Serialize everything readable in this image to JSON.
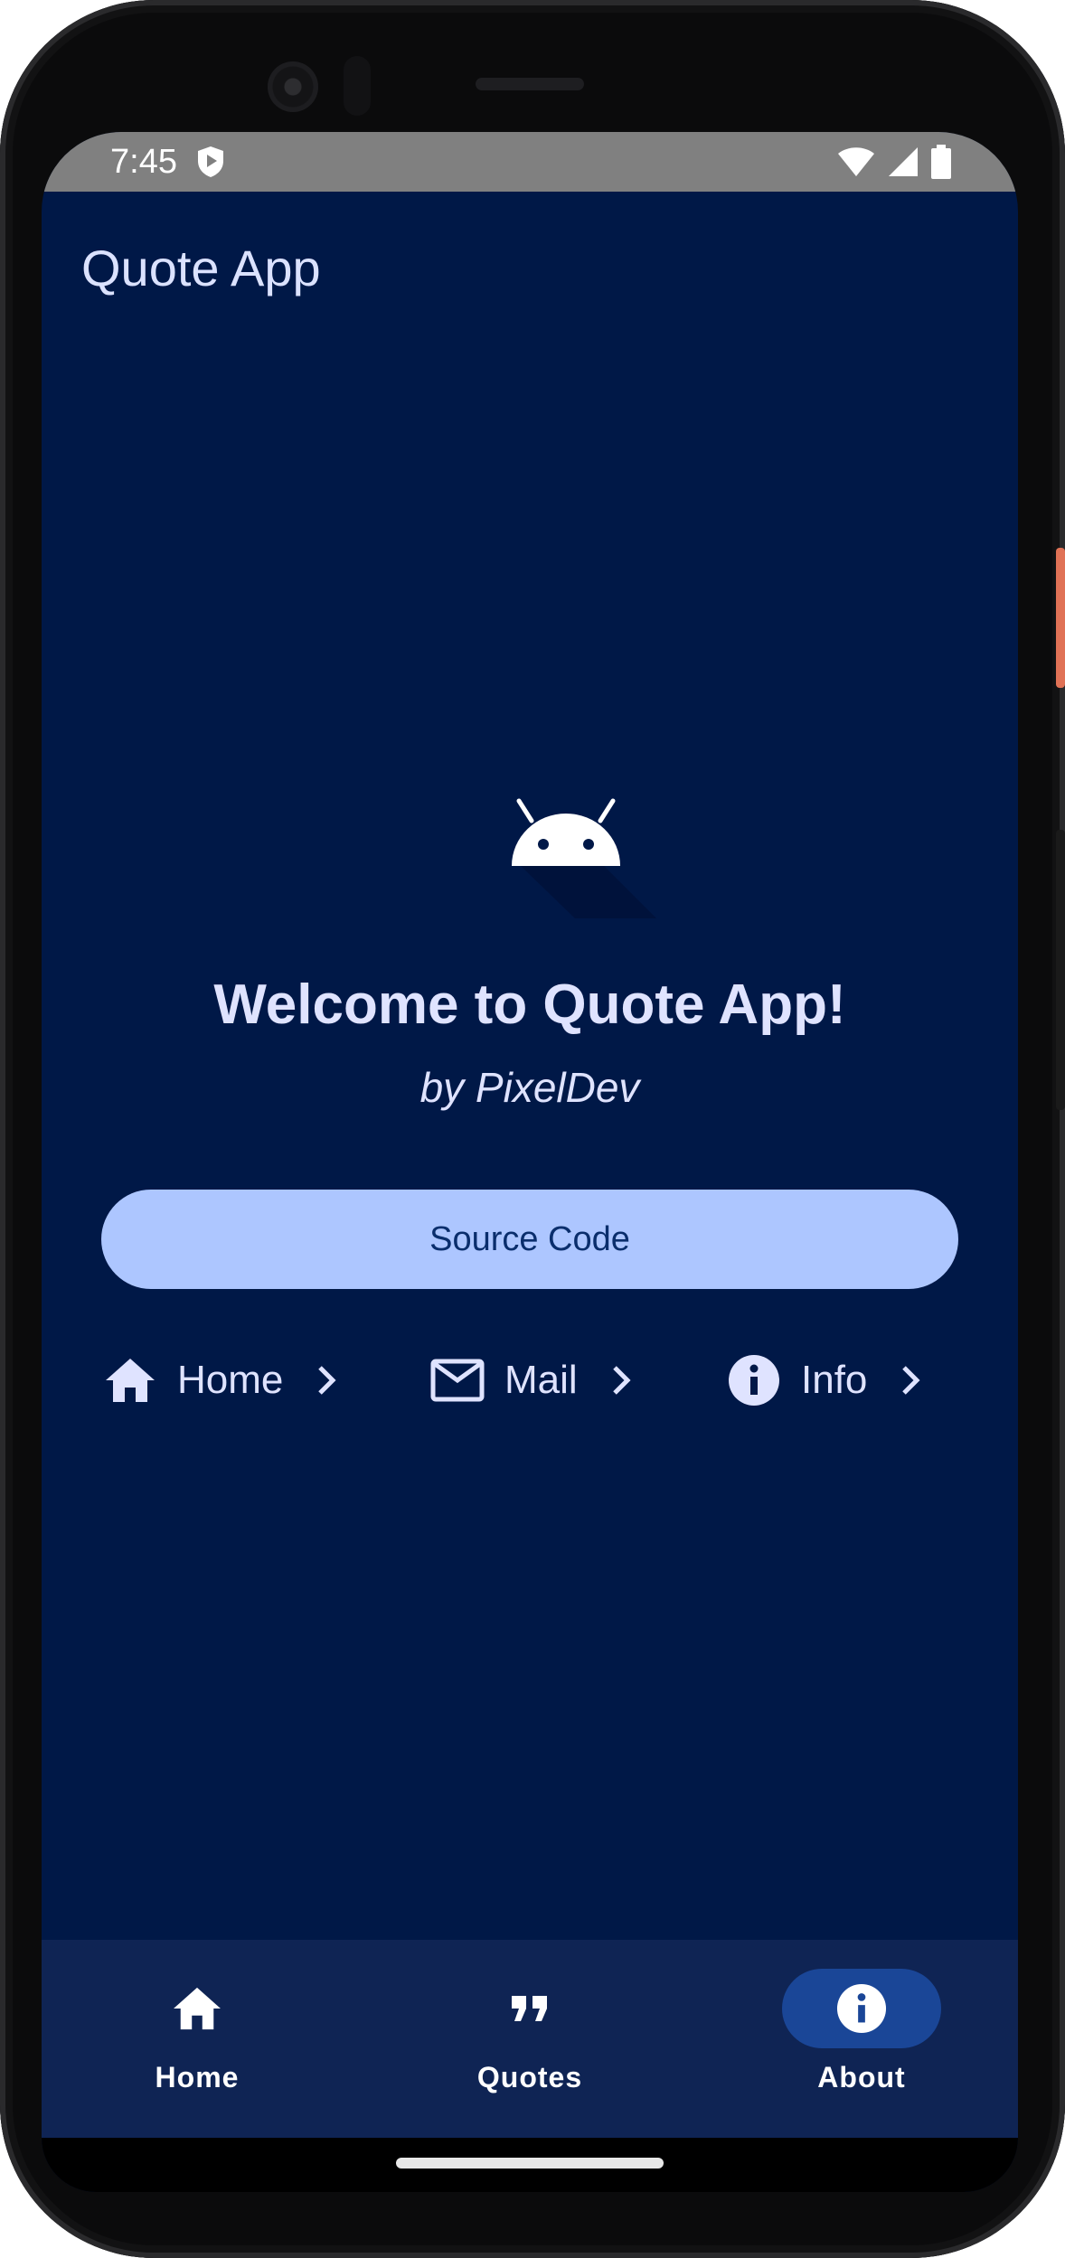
{
  "status_bar": {
    "time": "7:45",
    "icons": [
      "shield-play-icon",
      "wifi-icon",
      "signal-icon",
      "battery-icon"
    ]
  },
  "app_bar": {
    "title": "Quote App"
  },
  "content": {
    "logo_icon": "android-head-icon",
    "welcome_text": "Welcome to Quote App!",
    "byline": "by PixelDev",
    "source_button_label": "Source Code",
    "links": [
      {
        "icon": "home-icon",
        "label": "Home"
      },
      {
        "icon": "mail-icon",
        "label": "Mail"
      },
      {
        "icon": "info-icon",
        "label": "Info"
      }
    ]
  },
  "bottom_nav": {
    "items": [
      {
        "icon": "home-icon",
        "label": "Home",
        "active": false
      },
      {
        "icon": "format-quote-icon",
        "label": "Quotes",
        "active": false
      },
      {
        "icon": "info-icon",
        "label": "About",
        "active": true
      }
    ]
  },
  "colors": {
    "background": "#001847",
    "primary_container": "#adc6ff",
    "on_primary_container": "#0a2e6c",
    "nav_background": "#0f2454",
    "nav_active_indicator": "#1a4697",
    "on_surface": "#dfe3ff"
  }
}
